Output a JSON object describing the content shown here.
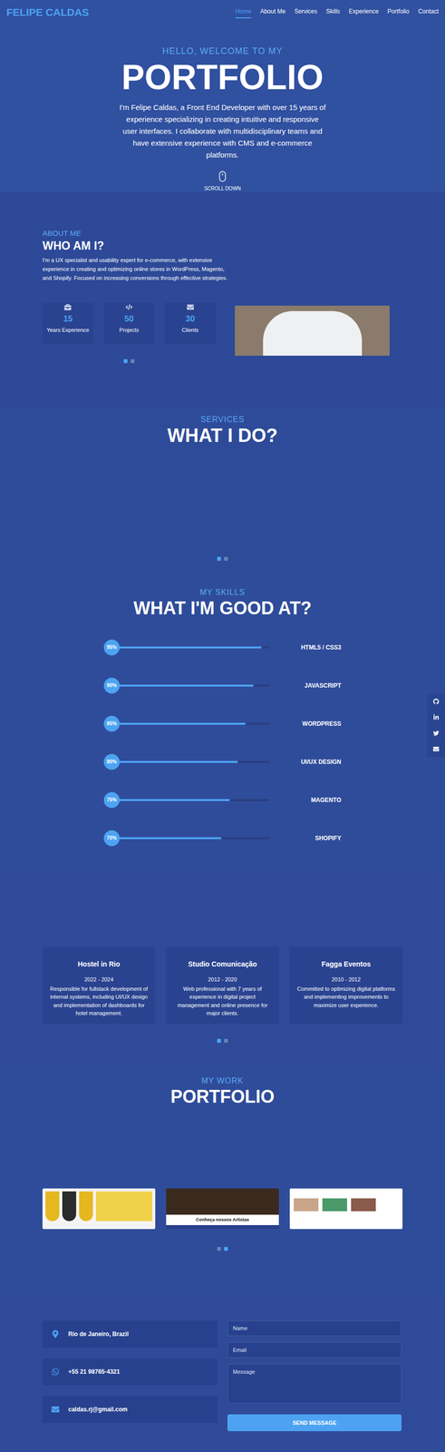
{
  "nav": {
    "logo": "FELIPE CALDAS",
    "links": [
      {
        "label": "Home",
        "selected": true
      },
      {
        "label": "About Me",
        "selected": false
      },
      {
        "label": "Services",
        "selected": false
      },
      {
        "label": "Skills",
        "selected": false
      },
      {
        "label": "Experience",
        "selected": false
      },
      {
        "label": "Portfolio",
        "selected": false
      },
      {
        "label": "Contact",
        "selected": false
      }
    ]
  },
  "hero": {
    "greeting": "HELLO, WELCOME TO MY",
    "title": "PORTFOLIO",
    "text": "I'm Felipe Caldas, a Front End Developer with over 15 years of experience specializing in creating intuitive and responsive user interfaces. I collaborate with multidisciplinary teams and have extensive experience with CMS and e-commerce platforms.",
    "scroll": "SCROLL DOWN"
  },
  "about": {
    "eyebrow": "ABOUT ME",
    "title": "WHO AM I?",
    "text": "I'm a UX specialist and usability expert for e-commerce, with extensive experience in creating and optimizing online stores in WordPress, Magento, and Shopify. Focused on increasing conversions through effective strategies.",
    "stats": [
      {
        "value": "15",
        "label": "Years Experience"
      },
      {
        "value": "50",
        "label": "Projects"
      },
      {
        "value": "30",
        "label": "Clients"
      }
    ],
    "dots": [
      {
        "selected": true
      },
      {
        "selected": false
      }
    ]
  },
  "services": {
    "eyebrow": "SERVICES",
    "title": "WHAT I DO?",
    "dots": [
      {
        "selected": true
      },
      {
        "selected": false
      }
    ]
  },
  "skills": {
    "eyebrow": "MY SKILLS",
    "title": "WHAT I'M GOOD AT?",
    "items": [
      {
        "name": "HTML5 / CSS3",
        "percent": "95%",
        "level": 0.95
      },
      {
        "name": "JAVASCRIPT",
        "percent": "90%",
        "level": 0.9
      },
      {
        "name": "WORDPRESS",
        "percent": "85%",
        "level": 0.85
      },
      {
        "name": "UI/UX DESIGN",
        "percent": "80%",
        "level": 0.8
      },
      {
        "name": "MAGENTO",
        "percent": "75%",
        "level": 0.75
      },
      {
        "name": "SHOPIFY",
        "percent": "70%",
        "level": 0.7
      }
    ]
  },
  "experience": {
    "items": [
      {
        "company": "Hostel in Rio",
        "period": "2022 - 2024",
        "text": "Responsible for fullstack development of internal systems, including UI/UX design and implementation of dashboards for hotel management."
      },
      {
        "company": "Studio Comunicação",
        "period": "2012 - 2020",
        "text": "Web professional with 7 years of experience in digital project management and online presence for major clients."
      },
      {
        "company": "Fagga Eventos",
        "period": "2010 - 2012",
        "text": "Committed to optimizing digital platforms and implementing improvements to maximize user experience."
      }
    ],
    "dots": [
      {
        "selected": true
      },
      {
        "selected": false
      }
    ]
  },
  "portfolio": {
    "eyebrow": "MY WORK",
    "title": "PORTFOLIO",
    "items": [
      {
        "caption": null
      },
      {
        "caption": "Conheça nossos Artistas"
      },
      {
        "caption": null
      }
    ],
    "dots": [
      {
        "selected": false
      },
      {
        "selected": true
      }
    ]
  },
  "contact": {
    "info": [
      {
        "text": "Rio de Janeiro, Brazil"
      },
      {
        "text": "+55 21 98765-4321"
      },
      {
        "text": "caldas.rj@gmail.com"
      }
    ],
    "form": {
      "name": "Name",
      "email": "Email",
      "message": "Message",
      "button": "SEND MESSAGE"
    }
  }
}
